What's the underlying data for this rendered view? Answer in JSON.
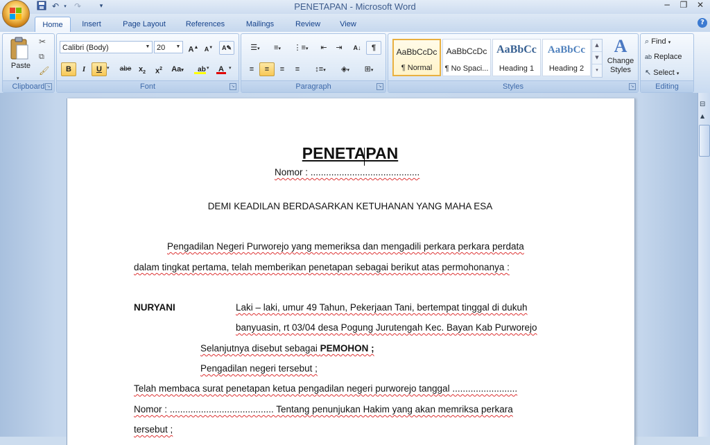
{
  "title": "PENETAPAN - Microsoft Word",
  "tabs": [
    "Home",
    "Insert",
    "Page Layout",
    "References",
    "Mailings",
    "Review",
    "View"
  ],
  "clipboard": {
    "paste": "Paste",
    "label": "Clipboard"
  },
  "font": {
    "name": "Calibri (Body)",
    "size": "20",
    "label": "Font"
  },
  "paragraph": {
    "label": "Paragraph"
  },
  "styles": {
    "label": "Styles",
    "items": [
      {
        "preview": "AaBbCcDc",
        "name": "¶ Normal"
      },
      {
        "preview": "AaBbCcDc",
        "name": "¶ No Spaci..."
      },
      {
        "preview": "AaBbCc",
        "name": "Heading 1"
      },
      {
        "preview": "AaBbCc",
        "name": "Heading 2"
      }
    ],
    "change": "Change Styles"
  },
  "editing": {
    "label": "Editing",
    "find": "Find",
    "replace": "Replace",
    "select": "Select"
  },
  "doc": {
    "heading": "PENETAPAN",
    "nomor": "Nomor :  ..........................................",
    "demi": "DEMI KEADILAN BERDASARKAN KETUHANAN YANG MAHA ESA",
    "p1a": "Pengadilan Negeri Purworejo yang memeriksa dan mengadili perkara perkara perdata",
    "p1b": "dalam tingkat pertama, telah memberikan penetapan  sebagai berikut atas permohonanya  :",
    "party_name": "NURYANI",
    "party_a": "Laki – laki, umur 49 Tahun, Pekerjaan Tani, bertempat  tinggal di dukuh",
    "party_b": "banyuasin,  rt 03/04 desa Pogung Jurutengah  Kec. Bayan Kab Purworejo",
    "selanjutnya": "Selanjutnya disebut  sebagai ",
    "pemohon": "PEMOHON ;",
    "pengadilan": "Pengadilan negeri tersebut ;",
    "telah": "Telah membaca surat penetapan  ketua  pengadilan negeri purworejo  tanggal  .........................",
    "nomor2": "Nomor :  ........................................  Tentang penunjukan  Hakim yang akan memriksa perkara",
    "tersebut": "tersebut ;"
  }
}
